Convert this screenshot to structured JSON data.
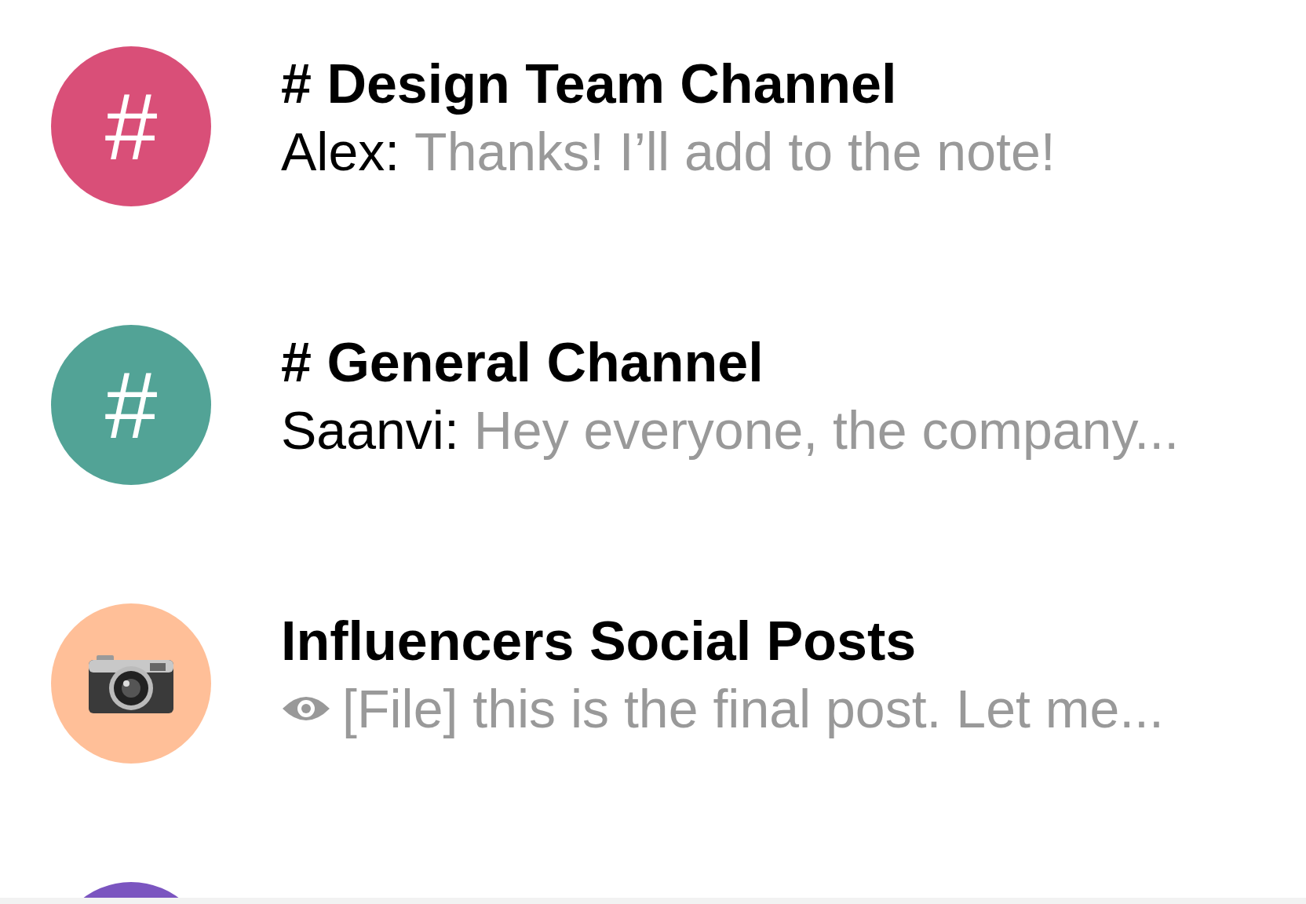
{
  "conversations": [
    {
      "avatar": {
        "kind": "hash",
        "color": "#d94f78",
        "glyph": "#"
      },
      "title": "# Design Team Channel",
      "preview": {
        "sender": "Alex:",
        "text": "Thanks! I’ll add to the note!"
      }
    },
    {
      "avatar": {
        "kind": "hash",
        "color": "#52a396",
        "glyph": "#"
      },
      "title": "# General Channel",
      "preview": {
        "sender": "Saanvi:",
        "text": "Hey everyone, the company..."
      }
    },
    {
      "avatar": {
        "kind": "camera",
        "color": "#ffbf98"
      },
      "title": "Influencers Social Posts",
      "preview": {
        "viewed": true,
        "text": "[File] this is the final post. Let me..."
      }
    },
    {
      "avatar": {
        "kind": "plain",
        "color": "#7b55c0"
      }
    }
  ]
}
